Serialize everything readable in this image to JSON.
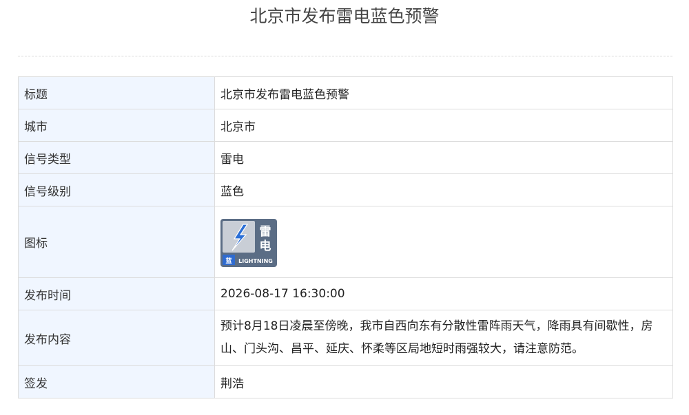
{
  "page_title": "北京市发布雷电蓝色预警",
  "rows": [
    {
      "label": "标题",
      "value": "北京市发布雷电蓝色预警"
    },
    {
      "label": "城市",
      "value": "北京市"
    },
    {
      "label": "信号类型",
      "value": "雷电"
    },
    {
      "label": "信号级别",
      "value": "蓝色"
    },
    {
      "label": "图标",
      "value": ""
    },
    {
      "label": "发布时间",
      "value": "2026-08-17 16:30:00"
    },
    {
      "label": "发布内容",
      "value": "预计8月18日凌晨至傍晚，我市自西向东有分散性雷阵雨天气，降雨具有间歇性，房山、门头沟、昌平、延庆、怀柔等区局地短时雨强较大，请注意防范。"
    },
    {
      "label": "签发",
      "value": "荆浩"
    }
  ],
  "icon": {
    "name": "lightning-blue-warning-icon",
    "chars": [
      "雷",
      "电"
    ],
    "level_char": "蓝",
    "english": "LIGHTNING",
    "colors": {
      "frame": "#5b6d85",
      "panel": "#c9ced6",
      "bolt": "#2b6fd6",
      "text": "#ffffff",
      "level_bg": "#2f6bd0"
    }
  }
}
